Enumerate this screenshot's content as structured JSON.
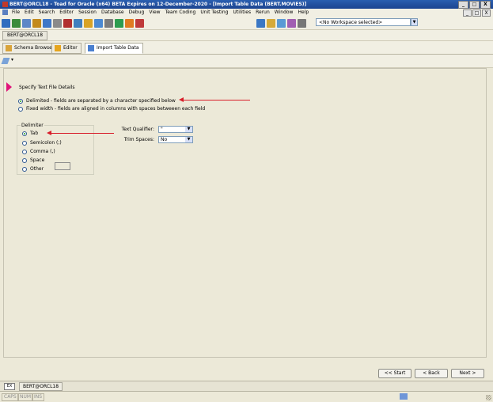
{
  "window": {
    "title": "BERT@ORCL18 - Toad for Oracle (x64) BETA Expires on 12-December-2020 - [Import Table Data (BERT.MOVIES)]",
    "controls": [
      "_",
      "□",
      "X"
    ]
  },
  "menubar": {
    "items": [
      "File",
      "Edit",
      "Search",
      "Editor",
      "Session",
      "Database",
      "Debug",
      "View",
      "Team Coding",
      "Unit Testing",
      "Utilities",
      "Rerun",
      "Window",
      "Help"
    ],
    "mdi_controls": [
      "_",
      "□",
      "X"
    ]
  },
  "toolbar": {
    "workspace_value": "<No Workspace selected>",
    "icons": [
      "connect-icon",
      "disconnect-icon",
      "schema-browser-icon",
      "editor-icon",
      "sql-icon",
      "grid-icon",
      "table-icon",
      "export-icon",
      "import-icon",
      "report-icon",
      "tools-icon",
      "compare-icon",
      "script-icon",
      "session-icon",
      "monitor-icon",
      "dbms-icon",
      "user-icon",
      "star-icon",
      "settings-icon"
    ],
    "colors": [
      "#2f6dbf",
      "#3c8c3c",
      "#5c87c7",
      "#c38a1d",
      "#3f78c8",
      "#8a8a8a",
      "#b12f2f",
      "#3f7fbf",
      "#d8a326",
      "#4b89d2",
      "#7c7c7c",
      "#2d9c4f",
      "#e07b20",
      "#bf3a3a",
      "#3b77c4",
      "#d6aa3a",
      "#5a9ad5",
      "#a15fb2",
      "#777777"
    ]
  },
  "connection_bar": {
    "label": "BERT@ORCL18"
  },
  "doc_tabs": [
    {
      "label": "Schema Browser",
      "active": false,
      "color": "#d9a43b"
    },
    {
      "label": "Editor",
      "active": false,
      "color": "#e6a51e"
    },
    {
      "label": "Import Table Data",
      "active": true,
      "color": "#4a7fd0"
    }
  ],
  "wizard": {
    "step_title": "Specify Text File Details",
    "format_options": [
      {
        "label": "Delimited - fields are separated by a character specified below",
        "checked": true
      },
      {
        "label": "Fixed width - fields are aligned in columns with spaces betweeen each field",
        "checked": false
      }
    ],
    "delimiter_group": {
      "legend": "Delimiter",
      "options": [
        {
          "label": "Tab",
          "checked": true
        },
        {
          "label": "Semicolon (;)",
          "checked": false
        },
        {
          "label": "Comma (,)",
          "checked": false
        },
        {
          "label": "Space",
          "checked": false
        },
        {
          "label": "Other",
          "checked": false
        }
      ],
      "other_value": ""
    },
    "text_qualifier": {
      "label": "Text Qualifier:",
      "value": "\""
    },
    "trim_spaces": {
      "label": "Trim Spaces:",
      "value": "No"
    },
    "buttons": {
      "start": "<< Start",
      "back": "< Back",
      "next": "Next >"
    }
  },
  "bottom_bar": {
    "expand": "EX",
    "connection": "BERT@ORCL18"
  },
  "status_bar": {
    "caps": "CAPS",
    "num": "NUM",
    "ins": "INS"
  },
  "annotation_color": "#d81e2a"
}
